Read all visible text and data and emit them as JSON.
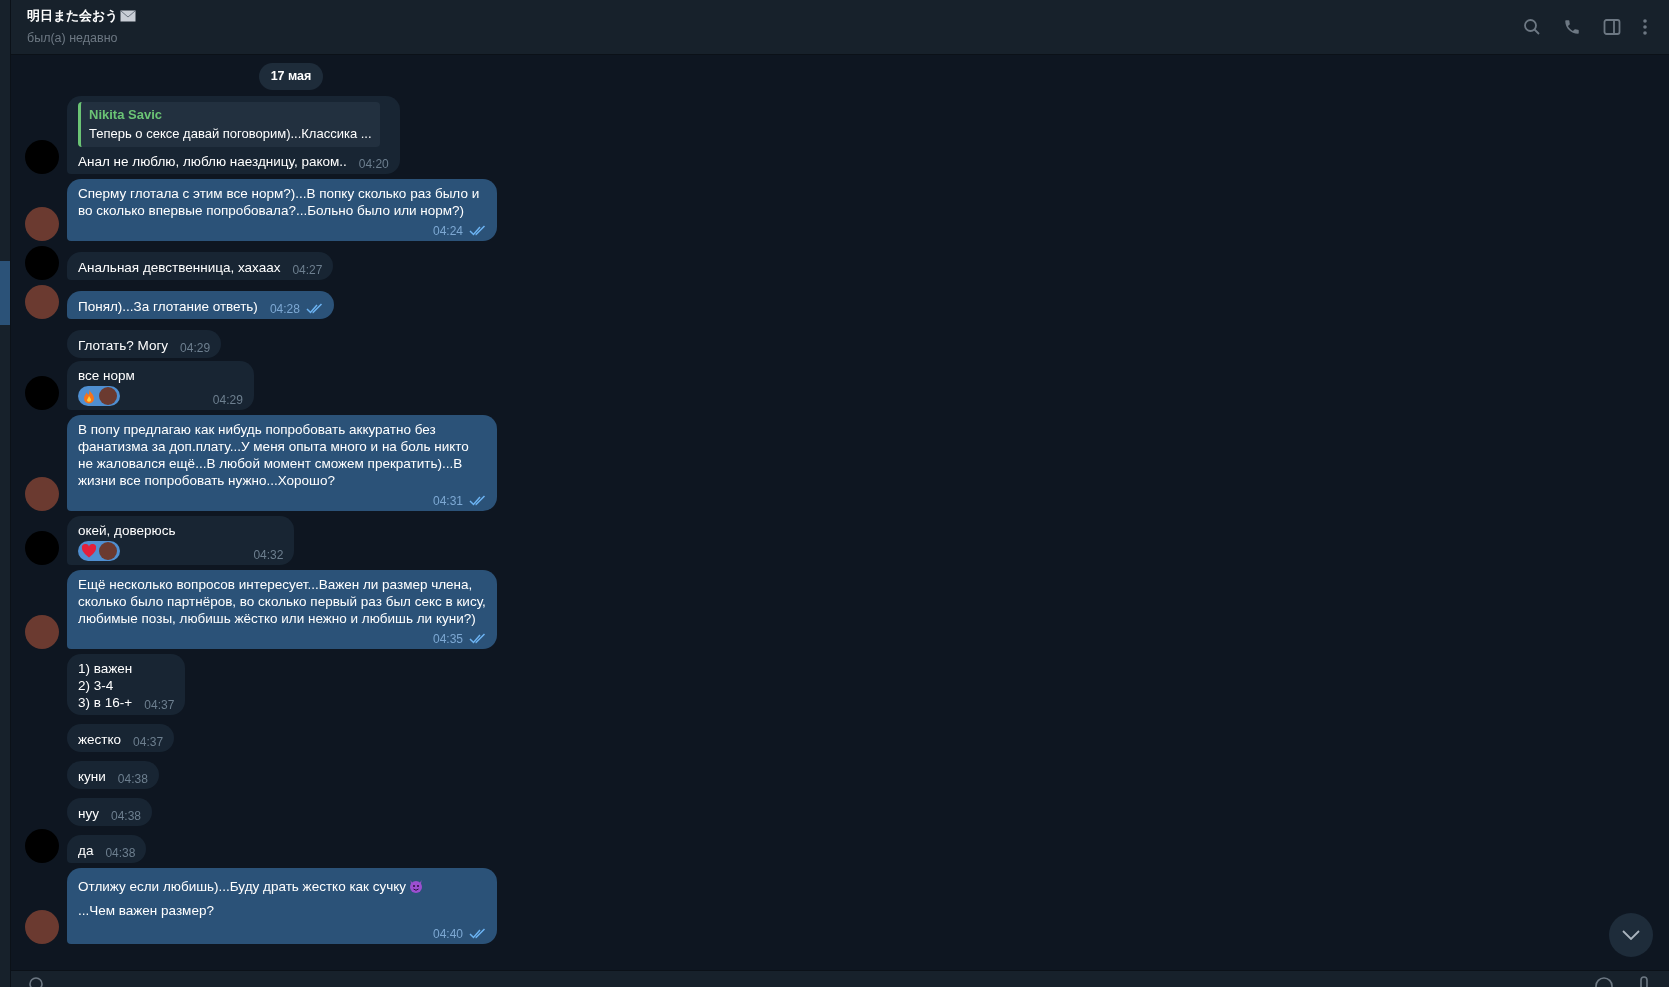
{
  "header": {
    "title": "明日また会おう",
    "subtitle": "был(а) недавно"
  },
  "date": "17 мая",
  "messages": [
    {
      "kind": "incoming",
      "avatar": true,
      "reply": {
        "name": "Nikita Savic",
        "text": "Теперь о сексе давай поговорим)...Классика ..."
      },
      "text": "Анал не люблю, люблю наездницу, раком..",
      "time": "04:20"
    },
    {
      "kind": "outgoing",
      "avatar": true,
      "text": "Сперму глотала с этим все норм?)...В попку сколько раз было и во сколько впервые попробовала?...Больно было или норм?)",
      "time": "04:24",
      "read": true
    },
    {
      "kind": "incoming",
      "avatar": true,
      "text": "Анальная девственница, хахаах",
      "time": "04:27"
    },
    {
      "kind": "outgoing",
      "avatar": true,
      "text": "Понял)...За глотание ответь)",
      "time": "04:28",
      "read": true
    },
    {
      "kind": "incoming",
      "avatar": false,
      "text": "Глотать? Могу",
      "time": "04:29"
    },
    {
      "kind": "incoming",
      "avatar": true,
      "text": "все норм",
      "time": "04:29",
      "reaction": {
        "kind": "fire"
      }
    },
    {
      "kind": "outgoing",
      "avatar": true,
      "text": "В попу предлагаю как нибудь попробовать аккуратно без фанатизма за доп.плату...У меня опыта много и на боль никто не жаловался ещё...В любой момент сможем прекратить)...В жизни все попробовать нужно...Хорошо?",
      "time": "04:31",
      "read": true
    },
    {
      "kind": "incoming",
      "avatar": true,
      "text": "окей, доверюсь",
      "time": "04:32",
      "reaction": {
        "kind": "heart"
      }
    },
    {
      "kind": "outgoing",
      "avatar": true,
      "text": "Ещё несколько вопросов интересует...Важен ли размер члена, сколько было партнёров, во сколько первый раз был секс в кису, любимые позы, любишь жёстко или нежно и любишь ли куни?)",
      "time": "04:35",
      "read": true
    },
    {
      "kind": "incoming",
      "avatar": false,
      "text": "1) важен\n2) 3-4\n3) в 16-+",
      "time": "04:37"
    },
    {
      "kind": "incoming",
      "avatar": false,
      "text": "жестко",
      "time": "04:37"
    },
    {
      "kind": "incoming",
      "avatar": false,
      "text": "куни",
      "time": "04:38"
    },
    {
      "kind": "incoming",
      "avatar": false,
      "text": "нуу",
      "time": "04:38"
    },
    {
      "kind": "incoming",
      "avatar": true,
      "text": "да",
      "time": "04:38"
    },
    {
      "kind": "outgoing",
      "avatar": true,
      "text": "Отлижу если любишь)...Буду драть жестко как сучку",
      "inline_emoji": {
        "kind": "devil"
      },
      "text_after": "...Чем важен размер?",
      "time": "04:40",
      "read": true
    }
  ]
}
